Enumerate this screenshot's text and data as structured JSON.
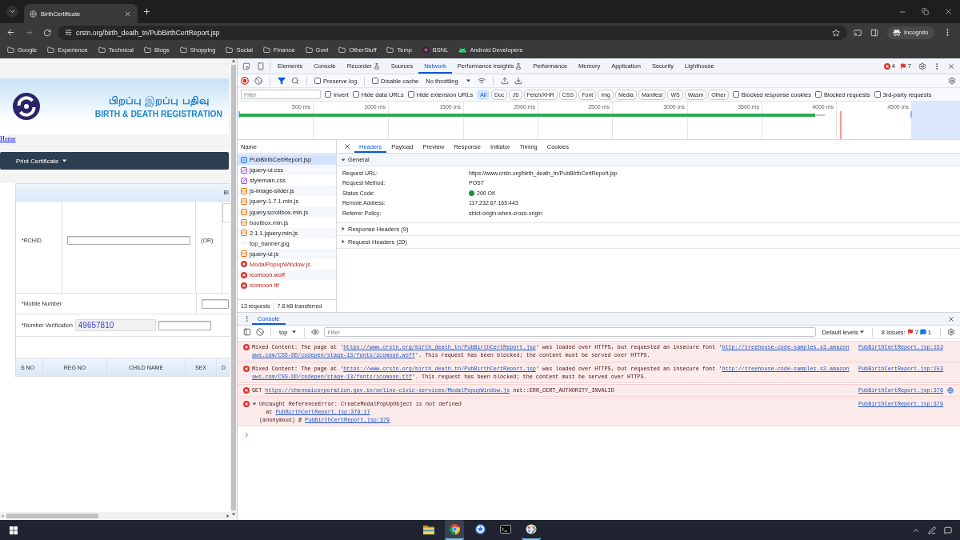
{
  "browser": {
    "tabs": [
      {
        "title": "BirthCertificate",
        "selected": true
      }
    ],
    "forward_disabled": true,
    "url": "crstn.org/birth_death_tn/PubBirthCertReport.jsp",
    "profile": "Incognito",
    "bookmarks": [
      {
        "label": "Google",
        "kind": "folder"
      },
      {
        "label": "Experience",
        "kind": "folder"
      },
      {
        "label": "Technical",
        "kind": "folder"
      },
      {
        "label": "Blogs",
        "kind": "folder"
      },
      {
        "label": "Shopping",
        "kind": "folder"
      },
      {
        "label": "Social",
        "kind": "folder"
      },
      {
        "label": "Finance",
        "kind": "folder"
      },
      {
        "label": "Govt",
        "kind": "folder"
      },
      {
        "label": "OtherStuff",
        "kind": "folder"
      },
      {
        "label": "Temp",
        "kind": "folder"
      },
      {
        "label": "BSNL",
        "kind": "page"
      },
      {
        "label": "Android Developers",
        "kind": "app"
      }
    ]
  },
  "page": {
    "banner": {
      "title_tamil": "பிறப்பு இறப்பு பதிவு",
      "title": "BIRTH & DEATH REGISTRATION"
    },
    "home_link": "Home",
    "menu": "Print Certificate",
    "form": {
      "header": "BI",
      "rchid_label": "*RCHID",
      "or_label": "(OR)",
      "mobile_label": "*Mobile Number",
      "verification_label": "*Number Verification",
      "captcha": "49657810"
    },
    "results_columns": [
      "S NO",
      "REG NO",
      "CHILD NAME",
      "SEX",
      "D"
    ]
  },
  "devtools": {
    "tabs": [
      {
        "label": "Elements",
        "selected": false,
        "experimental": false
      },
      {
        "label": "Console",
        "selected": false,
        "experimental": false
      },
      {
        "label": "Recorder",
        "selected": false,
        "experimental": true
      },
      {
        "label": "Sources",
        "selected": false,
        "experimental": false
      },
      {
        "label": "Network",
        "selected": true,
        "experimental": false
      },
      {
        "label": "Performance insights",
        "selected": false,
        "experimental": true
      },
      {
        "label": "Performance",
        "selected": false,
        "experimental": false
      },
      {
        "label": "Memory",
        "selected": false,
        "experimental": false
      },
      {
        "label": "Application",
        "selected": false,
        "experimental": false
      },
      {
        "label": "Security",
        "selected": false,
        "experimental": false
      },
      {
        "label": "Lighthouse",
        "selected": false,
        "experimental": false
      }
    ],
    "errors": "4",
    "issues": "7",
    "network": {
      "recording": true,
      "preserve_log": {
        "label": "Preserve log",
        "checked": false
      },
      "disable_cache": {
        "label": "Disable cache",
        "checked": false
      },
      "throttling": "No throttling",
      "filter": {
        "placeholder": "Filter"
      },
      "options": [
        {
          "label": "Invert",
          "checked": false
        },
        {
          "label": "Hide data URLs",
          "checked": false
        },
        {
          "label": "Hide extension URLs",
          "checked": false
        }
      ],
      "types": [
        {
          "label": "All",
          "selected": true
        },
        {
          "label": "Doc",
          "selected": false
        },
        {
          "label": "JS",
          "selected": false
        },
        {
          "label": "Fetch/XHR",
          "selected": false
        },
        {
          "label": "CSS",
          "selected": false
        },
        {
          "label": "Font",
          "selected": false
        },
        {
          "label": "Img",
          "selected": false
        },
        {
          "label": "Media",
          "selected": false
        },
        {
          "label": "Manifest",
          "selected": false
        },
        {
          "label": "WS",
          "selected": false
        },
        {
          "label": "Wasm",
          "selected": false
        },
        {
          "label": "Other",
          "selected": false
        }
      ],
      "more_options": [
        {
          "label": "Blocked response cookies",
          "checked": false
        },
        {
          "label": "Blocked requests",
          "checked": false
        },
        {
          "label": "3rd-party requests",
          "checked": false
        }
      ],
      "timeline_ticks": [
        "500 ms",
        "1000 ms",
        "1500 ms",
        "2000 ms",
        "2500 ms",
        "3000 ms",
        "3500 ms",
        "4000 ms",
        "4500 ms"
      ],
      "name_header": "Name",
      "requests": [
        {
          "name": "PubBirthCertReport.jsp",
          "kind": "document",
          "selected": true,
          "failed": false
        },
        {
          "name": "jquery-ui.css",
          "kind": "stylesheet",
          "selected": false,
          "failed": false
        },
        {
          "name": "stylemain.css",
          "kind": "stylesheet",
          "selected": false,
          "failed": false
        },
        {
          "name": "js-image-slider.js",
          "kind": "script",
          "selected": false,
          "failed": false
        },
        {
          "name": "jquery-1.7.1.min.js",
          "kind": "script",
          "selected": false,
          "failed": false
        },
        {
          "name": "jquery.scrollbox.min.js",
          "kind": "script",
          "selected": false,
          "failed": false
        },
        {
          "name": "bootbox.min.js",
          "kind": "script",
          "selected": false,
          "failed": false
        },
        {
          "name": "2.1.1.jquery.min.js",
          "kind": "script",
          "selected": false,
          "failed": false
        },
        {
          "name": "top_banner.jpg",
          "kind": "image",
          "selected": false,
          "failed": false
        },
        {
          "name": "jquery-ui.js",
          "kind": "script",
          "selected": false,
          "failed": false
        },
        {
          "name": "ModalPopupWindow.js",
          "kind": "script",
          "selected": false,
          "failed": true
        },
        {
          "name": "icomoon.woff",
          "kind": "font",
          "selected": false,
          "failed": true
        },
        {
          "name": "icomoon.ttf",
          "kind": "font",
          "selected": false,
          "failed": true
        }
      ],
      "summary": {
        "requests": "13 requests",
        "transferred": "7.8 kB transferred"
      },
      "detail_tabs": [
        {
          "label": "Headers",
          "selected": true
        },
        {
          "label": "Payload",
          "selected": false
        },
        {
          "label": "Preview",
          "selected": false
        },
        {
          "label": "Response",
          "selected": false
        },
        {
          "label": "Initiator",
          "selected": false
        },
        {
          "label": "Timing",
          "selected": false
        },
        {
          "label": "Cookies",
          "selected": false
        }
      ],
      "general": {
        "title": "General",
        "expanded": true,
        "rows": [
          {
            "key": "Request URL:",
            "value": "https://www.crstn.org/birth_death_tn/PubBirthCertReport.jsp",
            "kind": "text"
          },
          {
            "key": "Request Method:",
            "value": "POST",
            "kind": "text"
          },
          {
            "key": "Status Code:",
            "value": "200 OK",
            "kind": "status"
          },
          {
            "key": "Remote Address:",
            "value": "117.232.67.165:443",
            "kind": "text"
          },
          {
            "key": "Referrer Policy:",
            "value": "strict-origin-when-cross-origin",
            "kind": "text"
          }
        ]
      },
      "sections": [
        {
          "title": "Response Headers (9)",
          "expanded": false
        },
        {
          "title": "Request Headers (20)",
          "expanded": false
        }
      ]
    }
  },
  "console": {
    "tabs": [
      {
        "label": "Console",
        "selected": true
      }
    ],
    "context": "top",
    "filter": {
      "placeholder": "Filter"
    },
    "levels": "Default levels",
    "issues": {
      "label": "8 Issues:",
      "errors": "7",
      "info": "1"
    },
    "messages": [
      {
        "kind": "error",
        "lines": [
          [
            {
              "text": "Mixed Content: The page at '"
            },
            {
              "link": "https://www.crstn.org/birth_death_tn/PubBirthCertReport.jsp"
            },
            {
              "text": "' was loaded over HTTPS, but requested an insecure font '"
            },
            {
              "link": "http://treehouse-code-samples.s3.amazon"
            }
          ],
          [
            {
              "link": "aws.com/CSS-DD/codepen/stage-13/fonts/icomoon.woff"
            },
            {
              "text": "'. This request has been blocked; the content must be served over HTTPS."
            }
          ]
        ],
        "source": "PubBirthCertReport.jsp:153"
      },
      {
        "kind": "error",
        "lines": [
          [
            {
              "text": "Mixed Content: The page at '"
            },
            {
              "link": "https://www.crstn.org/birth_death_tn/PubBirthCertReport.jsp"
            },
            {
              "text": "' was loaded over HTTPS, but requested an insecure font '"
            },
            {
              "link": "http://treehouse-code-samples.s3.amazon"
            }
          ],
          [
            {
              "link": "aws.com/CSS-DD/codepen/stage-13/fonts/icomoon.ttf"
            },
            {
              "text": "'. This request has been blocked; the content must be served over HTTPS."
            }
          ]
        ],
        "source": "PubBirthCertReport.jsp:153"
      },
      {
        "kind": "network",
        "lines": [
          [
            {
              "text": "GET "
            },
            {
              "link": "https://chennaicorporation.gov.in/online-civic-services/ModalPopupWindow.js"
            },
            {
              "text": " net::ERR_CERT_AUTHORITY_INVALID"
            }
          ]
        ],
        "source": "PubBirthCertReport.jsp:376"
      },
      {
        "kind": "exception",
        "expanded": true,
        "lines": [
          [
            {
              "text": "Uncaught ReferenceError: CreateModalPopUpObject is not defined"
            }
          ],
          [
            {
              "text": "  at "
            },
            {
              "link": "PubBirthCertReport.jsp:379:17"
            }
          ],
          [
            {
              "text": "(anonymous) @ "
            },
            {
              "link": "PubBirthCertReport.jsp:379"
            }
          ]
        ],
        "source": "PubBirthCertReport.jsp:379"
      }
    ]
  },
  "taskbar": {
    "apps": [
      {
        "kind": "folder",
        "selected": false,
        "running": false
      },
      {
        "kind": "browser",
        "selected": true,
        "running": true
      },
      {
        "kind": "star",
        "selected": false,
        "running": false
      },
      {
        "kind": "terminal",
        "selected": false,
        "running": false
      },
      {
        "kind": "palette",
        "selected": false,
        "running": true
      }
    ]
  }
}
